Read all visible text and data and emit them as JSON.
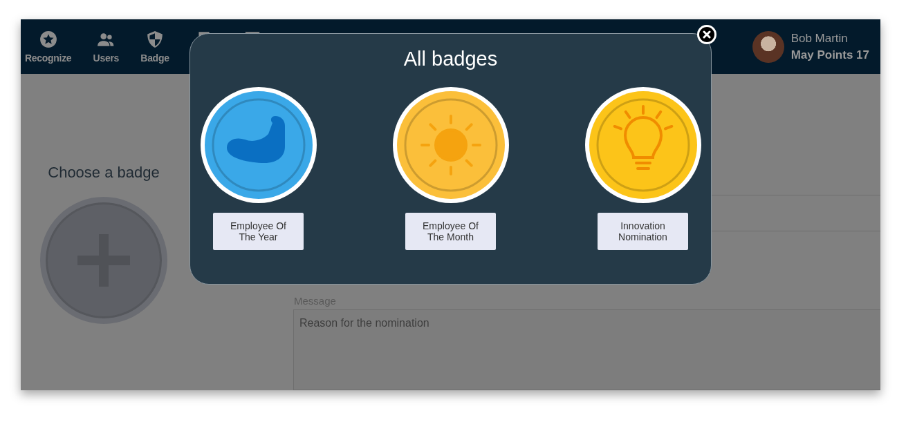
{
  "navbar": {
    "items": [
      {
        "kind": "star",
        "label": "Recognize"
      },
      {
        "kind": "users",
        "label": "Users"
      },
      {
        "kind": "shield",
        "label": "Badge"
      },
      {
        "kind": "trophy"
      },
      {
        "kind": "filter"
      }
    ],
    "user": {
      "name": "Bob Martin",
      "points": "May Points 17"
    }
  },
  "form": {
    "heading": "Choose a badge",
    "message_label": "Message",
    "message_placeholder": "Reason for the nomination"
  },
  "modal": {
    "title": "All badges",
    "badges": [
      {
        "kind": "arm",
        "color": "#3aa8e8",
        "label": "Employee Of The Year"
      },
      {
        "kind": "sun",
        "color": "#fbbf3a",
        "label": "Employee Of The Month"
      },
      {
        "kind": "bulb",
        "color": "#fcc419",
        "label": "Innovation Nomination"
      }
    ]
  }
}
